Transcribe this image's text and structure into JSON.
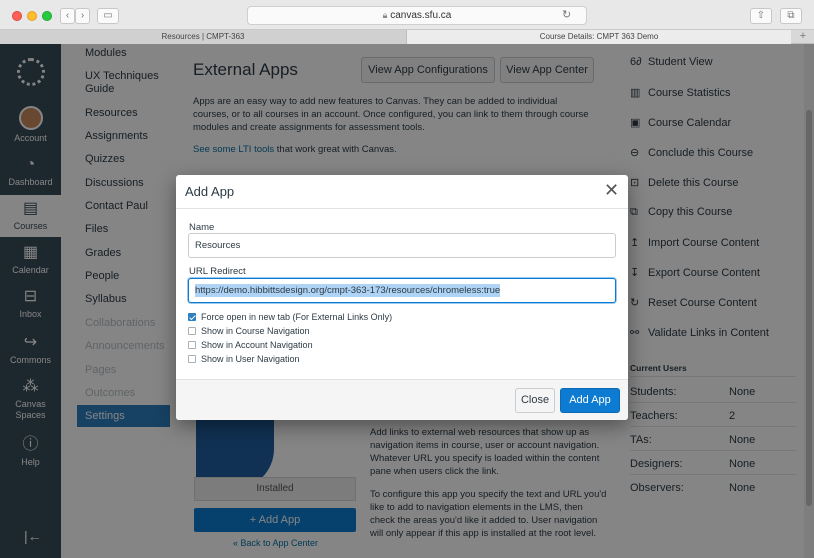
{
  "browser": {
    "address": "canvas.sfu.ca",
    "tabs": [
      {
        "label": "Resources | CMPT-363"
      },
      {
        "label": "Course Details: CMPT 363 Demo"
      }
    ],
    "new_tab": "+"
  },
  "global_nav": {
    "items": [
      {
        "label": "Account",
        "icon": "account-avatar"
      },
      {
        "label": "Dashboard",
        "icon": "dashboard-icon"
      },
      {
        "label": "Courses",
        "icon": "courses-icon",
        "active": true
      },
      {
        "label": "Calendar",
        "icon": "calendar-icon"
      },
      {
        "label": "Inbox",
        "icon": "inbox-icon"
      },
      {
        "label": "Commons",
        "icon": "commons-icon"
      },
      {
        "label": "Canvas Spaces",
        "icon": "spaces-icon"
      },
      {
        "label": "Help",
        "icon": "help-icon"
      }
    ],
    "collapse_icon": "collapse-icon"
  },
  "course_nav": {
    "items": [
      {
        "label": "Modules",
        "disabled": false
      },
      {
        "label": "UX Techniques Guide",
        "disabled": false
      },
      {
        "label": "Resources",
        "disabled": false
      },
      {
        "label": "Assignments",
        "disabled": false
      },
      {
        "label": "Quizzes",
        "disabled": false
      },
      {
        "label": "Discussions",
        "disabled": false
      },
      {
        "label": "Contact Paul",
        "disabled": false
      },
      {
        "label": "Files",
        "disabled": false
      },
      {
        "label": "Grades",
        "disabled": false
      },
      {
        "label": "People",
        "disabled": false
      },
      {
        "label": "Syllabus",
        "disabled": false
      },
      {
        "label": "Collaborations",
        "disabled": true
      },
      {
        "label": "Announcements",
        "disabled": true
      },
      {
        "label": "Pages",
        "disabled": true
      },
      {
        "label": "Outcomes",
        "disabled": true
      }
    ],
    "active": "Settings"
  },
  "main": {
    "title": "External Apps",
    "view_configs_button": "View App Configurations",
    "view_center_button": "View App Center",
    "intro": "Apps are an easy way to add new features to Canvas. They can be added to individual courses, or to all courses in an account. Once configured, you can link to them through course modules and create assignments for assessment tools.",
    "lti_link": "See some LTI tools",
    "lti_suffix": " that work great with Canvas.",
    "installed_label": "Installed",
    "add_app_button": "+ Add App",
    "back_link": "« Back to App Center",
    "desc_1": "Add links to external web resources that show up as navigation items in course, user or account navigation. Whatever URL you specify is loaded within the content pane when users click the link.",
    "desc_2": "To configure this app you specify the text and URL you'd like to add to navigation elements in the LMS, then check the areas you'd like it added to. User navigation will only appear if this app is installed at the root level."
  },
  "sidebar": {
    "actions": [
      {
        "label": "Student View",
        "icon": "student-view-icon",
        "glyph": "6∂"
      },
      {
        "label": "Course Statistics",
        "icon": "statistics-icon",
        "glyph": "▥"
      },
      {
        "label": "Course Calendar",
        "icon": "calendar-icon",
        "glyph": "▣"
      },
      {
        "label": "Conclude this Course",
        "icon": "lock-icon",
        "glyph": "⊖"
      },
      {
        "label": "Delete this Course",
        "icon": "trash-icon",
        "glyph": "⊡"
      },
      {
        "label": "Copy this Course",
        "icon": "copy-icon",
        "glyph": "⧉"
      },
      {
        "label": "Import Course Content",
        "icon": "import-icon",
        "glyph": "↥"
      },
      {
        "label": "Export Course Content",
        "icon": "export-icon",
        "glyph": "↧"
      },
      {
        "label": "Reset Course Content",
        "icon": "reset-icon",
        "glyph": "↻"
      },
      {
        "label": "Validate Links in Content",
        "icon": "link-icon",
        "glyph": "⚯"
      }
    ],
    "current_users_heading": "Current Users",
    "users": [
      {
        "role": "Students:",
        "count": "None"
      },
      {
        "role": "Teachers:",
        "count": "2"
      },
      {
        "role": "TAs:",
        "count": "None"
      },
      {
        "role": "Designers:",
        "count": "None"
      },
      {
        "role": "Observers:",
        "count": "None"
      }
    ]
  },
  "modal": {
    "title": "Add App",
    "name_label": "Name",
    "name_value": "Resources",
    "url_label": "URL Redirect",
    "url_value": "https://demo.hibbittsdesign.org/cmpt-363-173/resources/chromeless:true",
    "options": [
      {
        "label": "Force open in new tab (For External Links Only)",
        "checked": true
      },
      {
        "label": "Show in Course Navigation",
        "checked": false
      },
      {
        "label": "Show in Account Navigation",
        "checked": false
      },
      {
        "label": "Show in User Navigation",
        "checked": false
      }
    ],
    "close_button": "Close",
    "add_button": "Add App"
  },
  "colors": {
    "primary": "#0c7bd1",
    "nav_bg": "#394b58",
    "active_course_item": "#2d7fbf"
  }
}
